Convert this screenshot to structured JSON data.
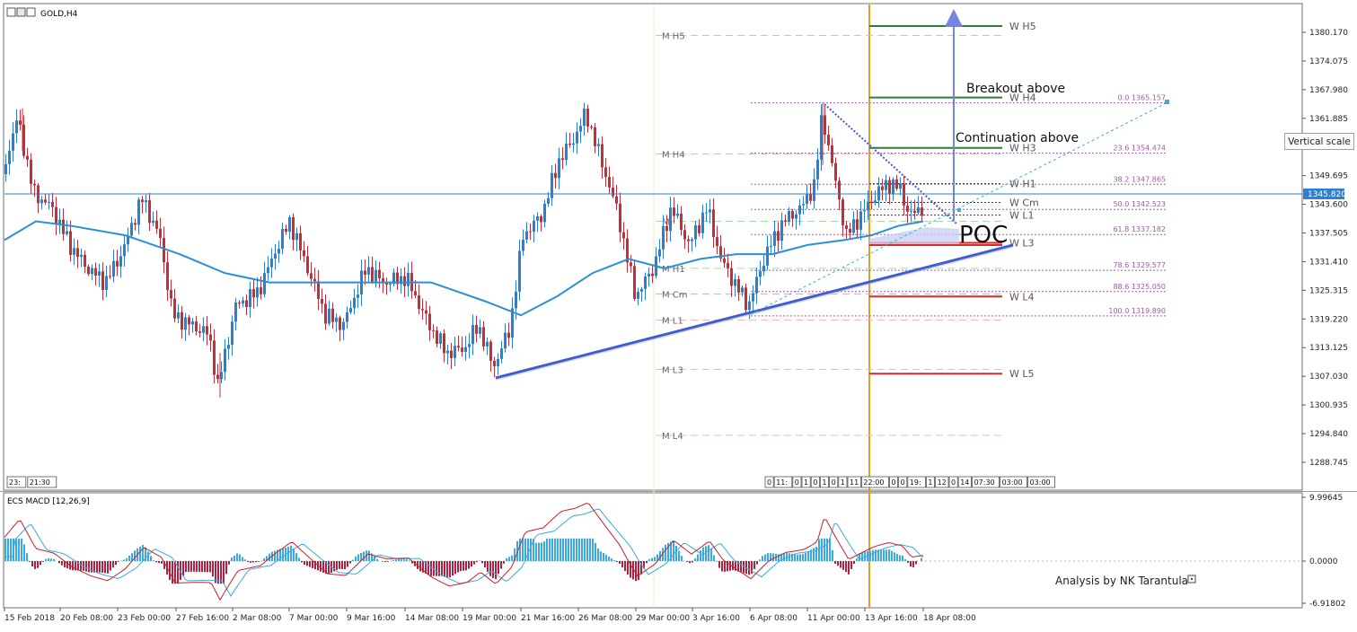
{
  "title": {
    "symbol": "GOLD,H4"
  },
  "vertical_scale_button": "Vertical scale",
  "indicator": {
    "name": "ECS MACD [12,26,9]"
  },
  "watermark": "Analysis by NK Tarantula",
  "annotations": {
    "poc": "POC",
    "breakout": "Breakout above",
    "continuation": "Continuation above"
  },
  "colors": {
    "bullish": "#2a7fd4",
    "bearish": "#c0303a",
    "ma": "#2b8fd8",
    "pivot_green": "#2e7d32",
    "pivot_red": "#d32f2f",
    "fib": "#a35aa8",
    "trendline": "#3f5bd0",
    "time_marker": "#e5a11a",
    "macd_signal": "#39a9e0",
    "macd_main": "#c8202a"
  },
  "price_axis": {
    "ticks": [
      "1380.170",
      "1374.075",
      "1367.980",
      "1361.885",
      "1355.790",
      "1349.695",
      "1343.600",
      "1337.505",
      "1331.410",
      "1325.315",
      "1319.220",
      "1313.125",
      "1307.030",
      "1300.935",
      "1294.840",
      "1288.745"
    ],
    "current": "1345.820",
    "current_value": 1345.82
  },
  "macd_axis": {
    "ticks": [
      "9.99645",
      "0.0000",
      "-6.91802"
    ]
  },
  "time_axis": {
    "labels": [
      "15 Feb 2018",
      "20 Feb 08:00",
      "23 Feb 00:00",
      "27 Feb 16:00",
      "2 Mar 08:00",
      "7 Mar 00:00",
      "9 Mar 16:00",
      "14 Mar 08:00",
      "19 Mar 00:00",
      "21 Mar 16:00",
      "26 Mar 08:00",
      "29 Mar 00:00",
      "3 Apr 16:00",
      "6 Apr 08:00",
      "11 Apr 00:00",
      "13 Apr 16:00",
      "18 Apr 08:00"
    ]
  },
  "fib_levels": [
    {
      "label": "0.0  1365.157",
      "price": 1365.157
    },
    {
      "label": "23.6  1354.474",
      "price": 1354.474
    },
    {
      "label": "38.2  1347.865",
      "price": 1347.865
    },
    {
      "label": "50.0  1342.523",
      "price": 1342.523
    },
    {
      "label": "61.8  1337.182",
      "price": 1337.182
    },
    {
      "label": "78.6  1329.577",
      "price": 1329.577
    },
    {
      "label": "88.6  1325.050",
      "price": 1325.05
    },
    {
      "label": "100.0  1319.890",
      "price": 1319.89
    }
  ],
  "weekly_pivots": [
    {
      "label": "W  H5",
      "price": 1381.5,
      "tone": "green"
    },
    {
      "label": "W  H4",
      "price": 1366.3,
      "tone": "green"
    },
    {
      "label": "W  H3",
      "price": 1355.6,
      "tone": "green"
    },
    {
      "label": "W  H1",
      "price": 1348.0,
      "tone": "dark"
    },
    {
      "label": "W  Cm",
      "price": 1344.0,
      "tone": "dark"
    },
    {
      "label": "W  L1",
      "price": 1341.3,
      "tone": "dark"
    },
    {
      "label": "W  L3",
      "price": 1335.4,
      "tone": "red"
    },
    {
      "label": "W  L4",
      "price": 1324.0,
      "tone": "red"
    },
    {
      "label": "W  L5",
      "price": 1307.6,
      "tone": "red"
    }
  ],
  "monthly_pivots": [
    {
      "label": "M  H5",
      "price": 1379.5
    },
    {
      "label": "M  H4",
      "price": 1354.3
    },
    {
      "label": "M",
      "price": 1340.0
    },
    {
      "label": "M  H1",
      "price": 1330.0
    },
    {
      "label": "M  Cm",
      "price": 1324.5
    },
    {
      "label": "M  L1",
      "price": 1319.0
    },
    {
      "label": "M  L3",
      "price": 1308.5
    },
    {
      "label": "M  L4",
      "price": 1294.5
    }
  ],
  "session_labels_left": [
    "23:",
    "21:30"
  ],
  "session_labels_right": [
    "0",
    "11:",
    "0",
    "1",
    "0",
    "1",
    "0",
    "1",
    "11",
    "22:00",
    "0",
    "0",
    "19:",
    "1",
    "12",
    "0",
    "14",
    "07:30",
    "03:00",
    "03:00"
  ]
}
